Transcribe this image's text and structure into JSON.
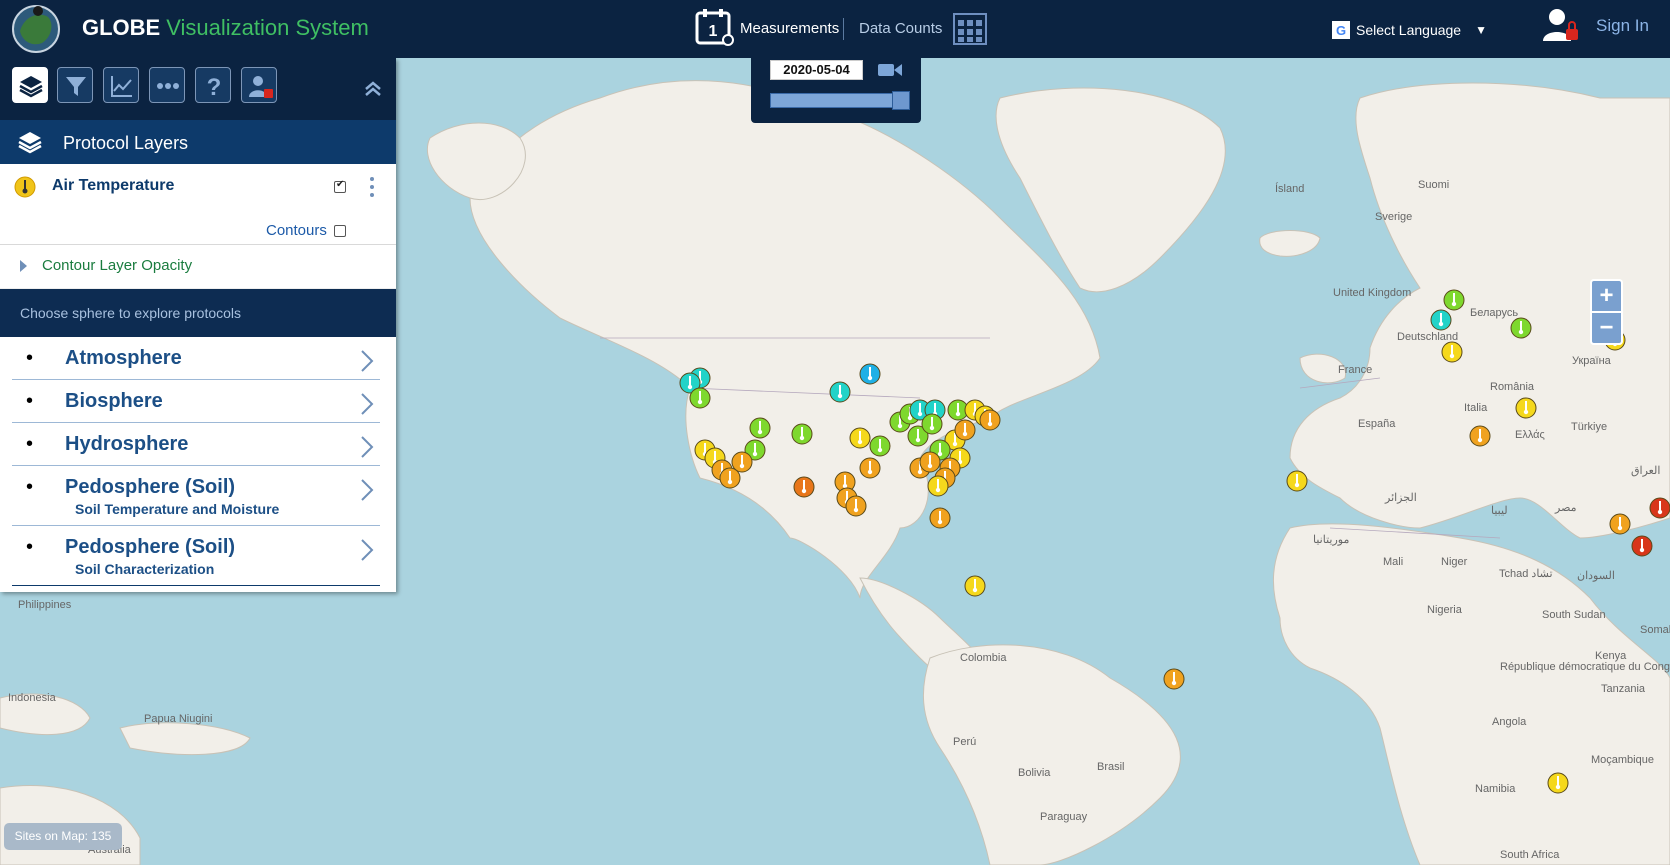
{
  "header": {
    "brand": "GLOBE",
    "brand_sub": "Visualization System",
    "measurements": "Measurements",
    "data_counts": "Data Counts",
    "calendar_day": "1",
    "language": "Select Language",
    "sign_in": "Sign In"
  },
  "time_control": {
    "date": "2020-05-04",
    "slider_position": 1.0
  },
  "panel": {
    "title": "Protocol Layers",
    "layer": {
      "name": "Air Temperature",
      "checked": true
    },
    "contours_label": "Contours",
    "opacity_label": "Contour Layer Opacity",
    "choose_label": "Choose sphere to explore protocols",
    "spheres": [
      {
        "name": "Atmosphere",
        "sub": ""
      },
      {
        "name": "Biosphere",
        "sub": ""
      },
      {
        "name": "Hydrosphere",
        "sub": ""
      },
      {
        "name": "Pedosphere (Soil)",
        "sub": "Soil Temperature and Moisture"
      },
      {
        "name": "Pedosphere (Soil)",
        "sub": "Soil Characterization"
      }
    ]
  },
  "map": {
    "sites_label": "Sites on Map: 135",
    "zoom_in": "+",
    "zoom_out": "−",
    "labels": [
      "Ísland",
      "Suomi",
      "Sverige",
      "United Kingdom",
      "Беларусь",
      "Deutschland",
      "France",
      "România",
      "Україна",
      "España",
      "Italia",
      "Ελλάς",
      "Türkiye",
      "العراق",
      "الجزائر",
      "ليبيا",
      "مصر",
      "موريتانيا",
      "Mali",
      "Niger",
      "Tchad تشاد",
      "السودان",
      "Nigeria",
      "South Sudan",
      "Kenya",
      "Somalia",
      "République démocratique du Congo",
      "Tanzania",
      "Angola",
      "Moçambique",
      "Namibia",
      "South Africa",
      "Colombia",
      "Perú",
      "Brasil",
      "Bolivia",
      "Paraguay",
      "Philippines",
      "Indonesia",
      "Papua Niugini",
      "Australia"
    ],
    "colors": {
      "cyan": "#22d3c8",
      "blue": "#1fb0e6",
      "green": "#7ed82e",
      "yellow": "#f5d81c",
      "orange": "#f0a21f",
      "dark_orange": "#e8761a",
      "red": "#d8361a"
    }
  }
}
